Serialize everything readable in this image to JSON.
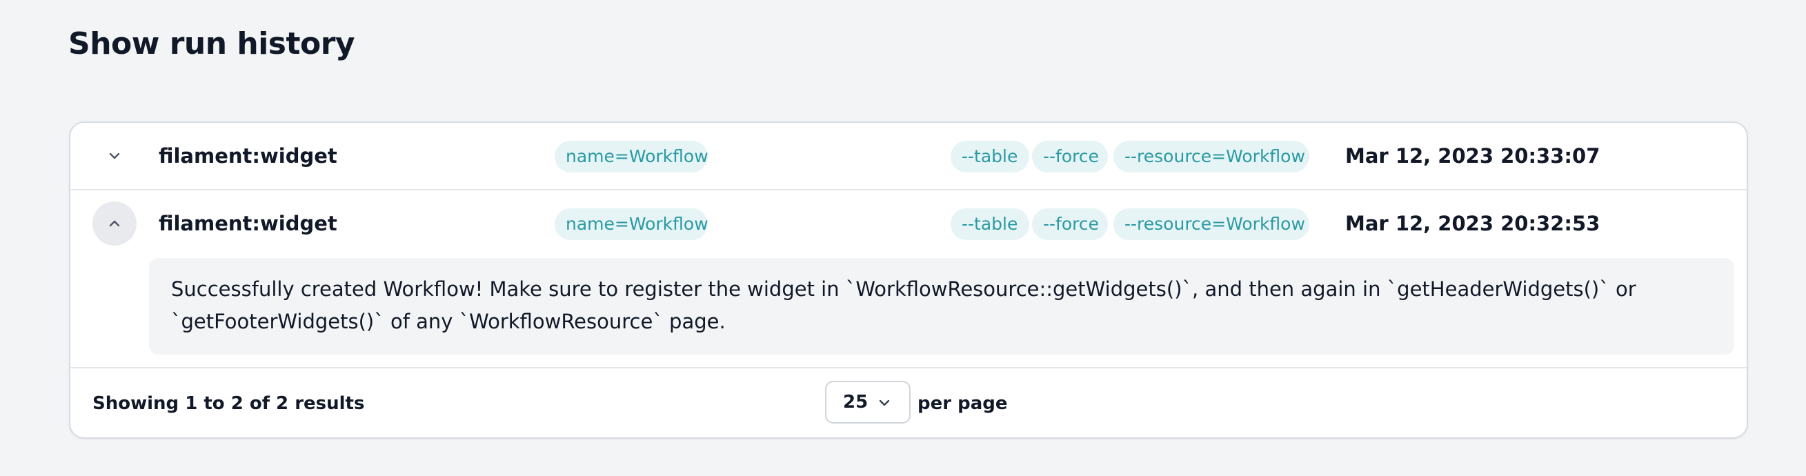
{
  "page": {
    "title": "Show run history"
  },
  "rows": [
    {
      "command": "filament:widget",
      "arguments": [
        "name=Workflow"
      ],
      "options": [
        "--table",
        "--force",
        "--resource=Workflow"
      ],
      "ran_at": "Mar 12, 2023 20:33:07",
      "expanded": false,
      "toggle_icon": "chevron-down-icon"
    },
    {
      "command": "filament:widget",
      "arguments": [
        "name=Workflow"
      ],
      "options": [
        "--table",
        "--force",
        "--resource=Workflow"
      ],
      "ran_at": "Mar 12, 2023 20:32:53",
      "expanded": true,
      "toggle_icon": "chevron-up-icon",
      "output_lines": [
        "Successfully created Workflow! Make sure to register the widget in `WorkflowResource::getWidgets()`, and then again in `getHeaderWidgets()` or",
        "`getFooterWidgets()` of any `WorkflowResource` page."
      ]
    }
  ],
  "pagination": {
    "summary": "Showing 1 to 2 of 2 results",
    "per_page_value": "25",
    "per_page_label": "per page",
    "select_icon": "chevron-down-icon"
  },
  "colors": {
    "background": "#f3f4f6",
    "chip_bg": "#e6f4f5",
    "chip_text": "#2a9aa3",
    "text": "#111827"
  }
}
